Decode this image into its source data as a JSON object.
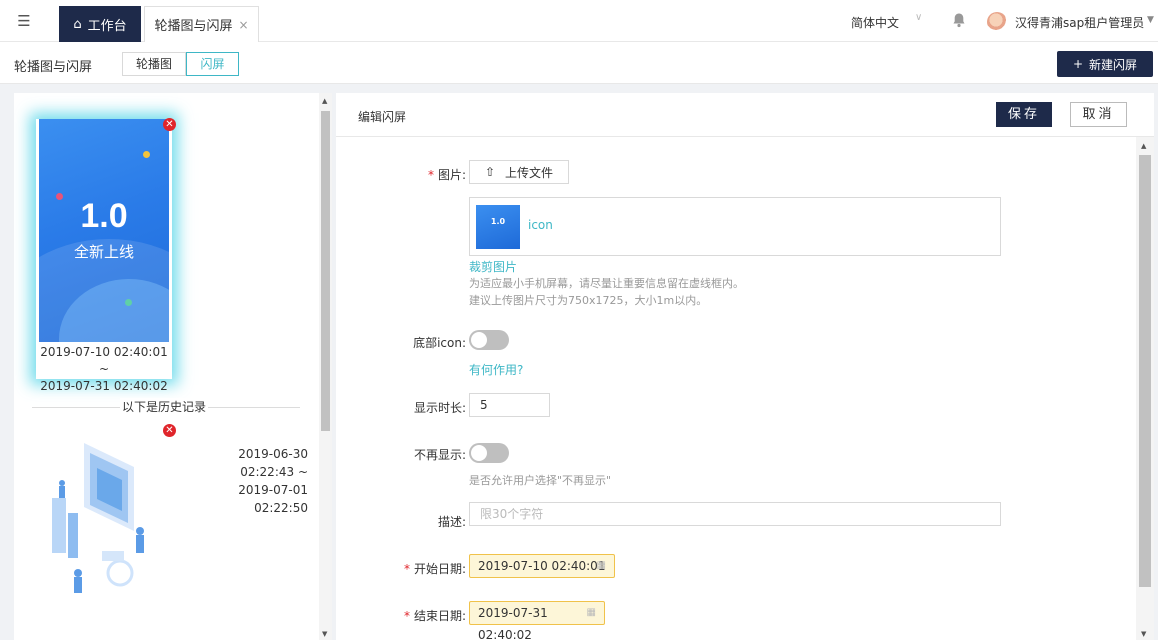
{
  "topbar": {
    "home_tab": "工作台",
    "active_tab": "轮播图与闪屏",
    "close_glyph": "×",
    "language": "简体中文",
    "user_name": "汉得青浦sap租户管理员",
    "icons": [
      "menu-toggle-icon",
      "home-icon",
      "close-icon",
      "chevron-down-icon",
      "bell-icon",
      "avatar"
    ]
  },
  "subbar": {
    "title": "轮播图与闪屏",
    "segments": [
      "轮播图",
      "闪屏"
    ],
    "selected_segment": "闪屏",
    "new_button": "新建闪屏"
  },
  "left": {
    "current": {
      "big_text": "1.0",
      "caption": "全新上线",
      "start": "2019-07-10 02:40:01 ~",
      "end": "2019-07-31 02:40:02"
    },
    "history_label": "以下是历史记录",
    "history": [
      {
        "start": "2019-06-30 02:22:43 ~",
        "end": "2019-07-01 02:22:50"
      }
    ]
  },
  "editor": {
    "title": "编辑闪屏",
    "save": "保存",
    "cancel": "取消",
    "fields": {
      "image_label": "图片:",
      "upload_button": "上传文件",
      "file_name": "icon",
      "crop_link": "裁剪图片",
      "hint_line1": "为适应最小手机屏幕，请尽量让重要信息留在虚线框内。",
      "hint_line2": "建议上传图片尺寸为750x1725，大小1m以内。",
      "bottom_icon_label": "底部icon:",
      "bottom_icon_on": false,
      "what_for_link": "有何作用?",
      "duration_label": "显示时长:",
      "duration_value": "5",
      "no_show_label": "不再显示:",
      "no_show_on": false,
      "no_show_hint": "是否允许用户选择\"不再显示\"",
      "desc_label": "描述:",
      "desc_placeholder": "限30个字符",
      "start_label": "开始日期:",
      "start_value": "2019-07-10 02:40:01",
      "end_label": "结束日期:",
      "end_value": "2019-07-31 02:40:02"
    }
  },
  "colors": {
    "navy": "#1e2a4a",
    "teal": "#3eb7c6",
    "required": "#e0252b",
    "date_bg": "#fdf6d8",
    "date_border": "#f0c24a"
  }
}
